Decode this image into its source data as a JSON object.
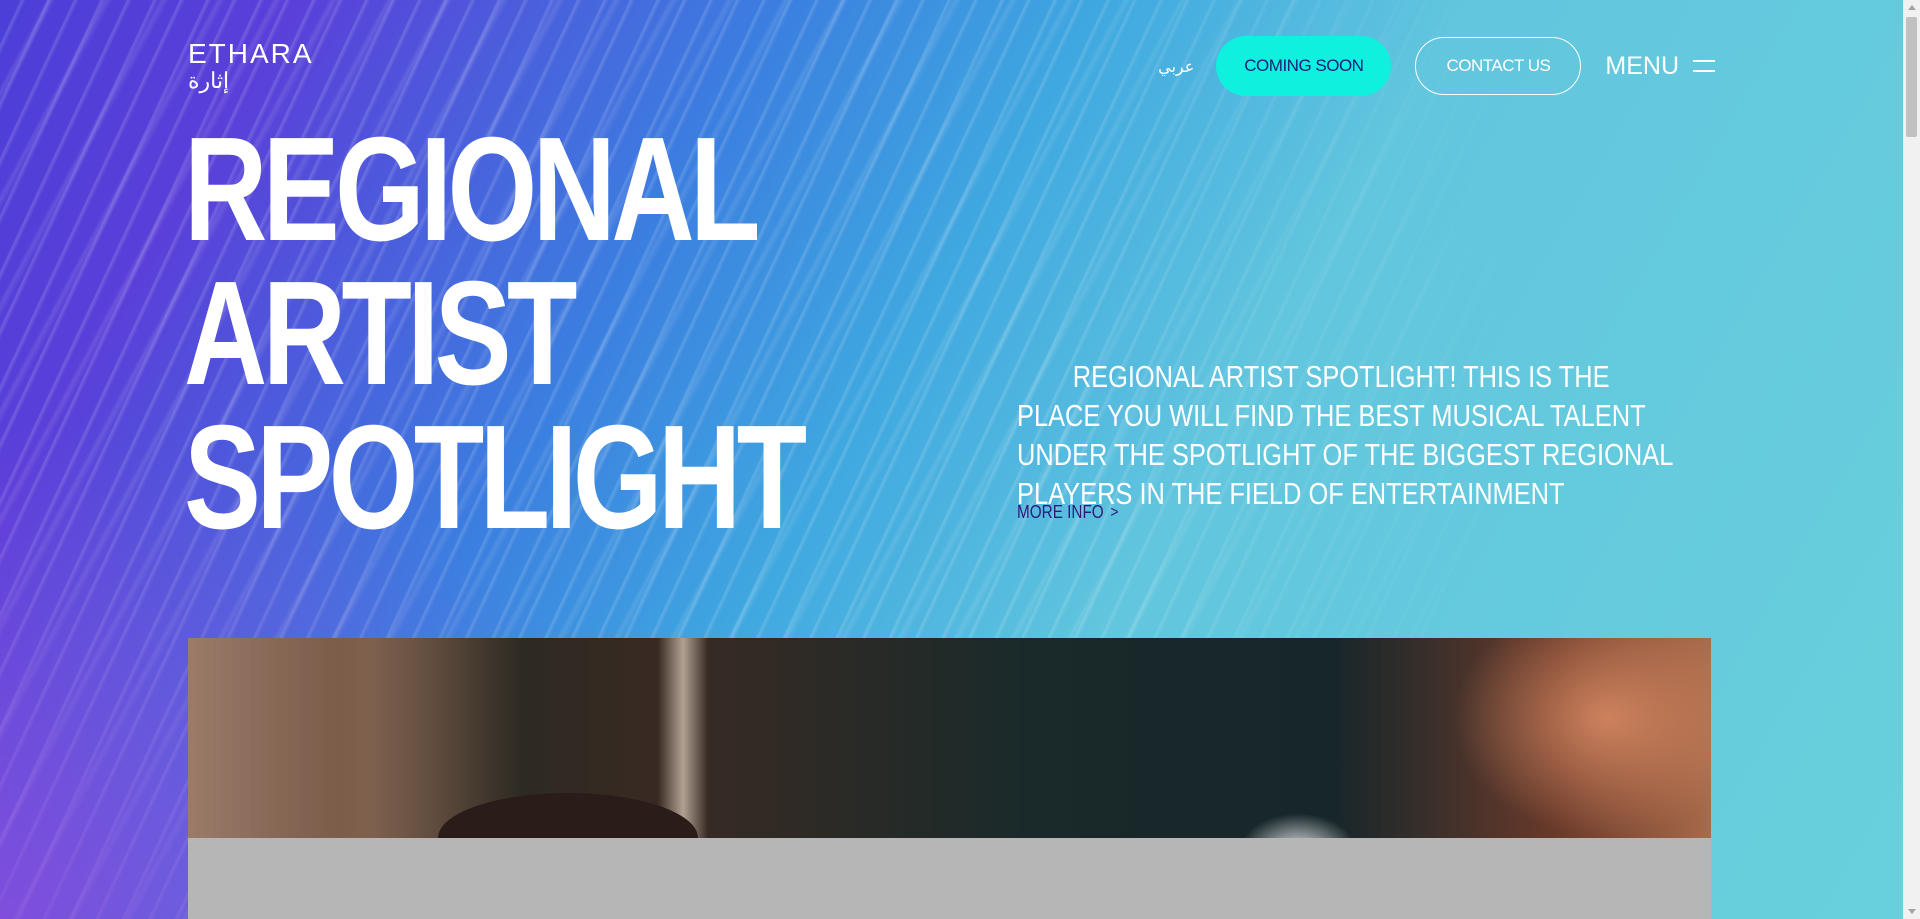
{
  "header": {
    "logo_en": "ETHARA",
    "logo_ar": "إثارة",
    "language_toggle": "عربي",
    "coming_soon_label": "COMING SOON",
    "contact_label": "CONTACT US",
    "menu_label": "MENU"
  },
  "hero": {
    "title": "REGIONAL\nARTIST\nSPOTLIGHT",
    "description": "REGIONAL ARTIST SPOTLIGHT! THIS IS THE PLACE YOU WILL FIND THE BEST MUSICAL TALENT UNDER THE SPOTLIGHT OF THE BIGGEST REGIONAL PLAYERS IN THE FIELD OF ENTERTAINMENT",
    "more_info_label": "MORE INFO"
  },
  "colors": {
    "accent": "#10f0de",
    "link": "#2b1a7a",
    "gradient_left": "#4b3fd8",
    "gradient_right": "#68d0dc"
  },
  "icons": {
    "menu": "hamburger-icon",
    "more_info": "chevron-right-icon"
  }
}
